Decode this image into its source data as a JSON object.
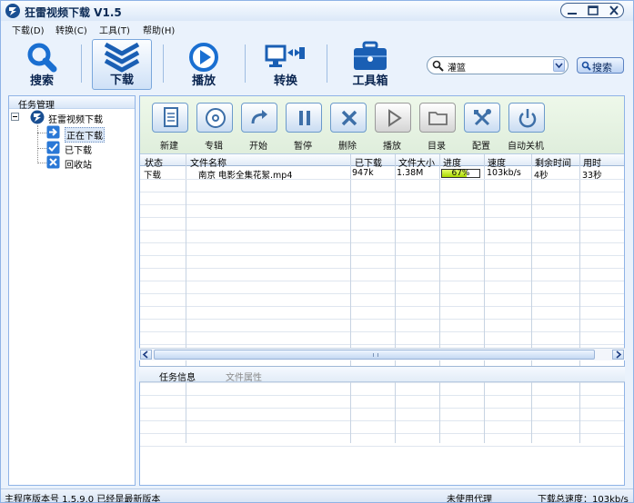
{
  "app": {
    "title": "狂雷视频下载  V1.5"
  },
  "menu": [
    "下载(D)",
    "转换(C)",
    "工具(T)",
    "帮助(H)"
  ],
  "toolbar": {
    "search": "搜索",
    "download": "下载",
    "play": "播放",
    "convert": "转换",
    "toolbox": "工具箱"
  },
  "search": {
    "value": "灌篮",
    "button": "搜索"
  },
  "tree": {
    "header": "任务管理",
    "root": "狂雷视频下载",
    "items": [
      "正在下载",
      "已下载",
      "回收站"
    ]
  },
  "actions": [
    "新建",
    "专辑",
    "开始",
    "暂停",
    "删除",
    "播放",
    "目录",
    "配置",
    "自动关机"
  ],
  "table": {
    "columns": [
      "状态",
      "文件名称",
      "已下载",
      "文件大小",
      "进度",
      "速度",
      "剩余时间",
      "用时"
    ],
    "rows": [
      {
        "status": "下载",
        "name": "南京 电影全集花絮.mp4",
        "downloaded": "947k",
        "size": "1.38M",
        "progress": 0.67,
        "progress_label": "67%",
        "speed": "103kb/s",
        "remaining": "4秒",
        "elapsed": "33秒"
      }
    ]
  },
  "info_tabs": [
    "任务信息",
    "文件属性"
  ],
  "status": {
    "version": "主程序版本号 1.5.9.0  已经是最新版本",
    "proxy": "未使用代理",
    "total_speed": "下载总速度：103kb/s"
  },
  "colors": {
    "accent": "#1a5fb4",
    "progress": "#b8e400",
    "title_text": "#0b2a55"
  }
}
